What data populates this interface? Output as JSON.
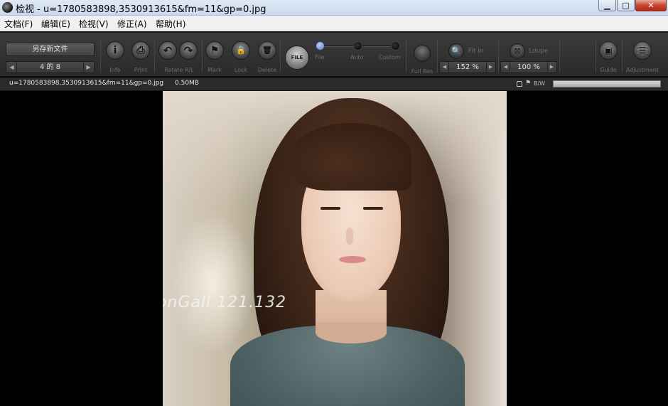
{
  "window": {
    "title": "检视 - u=1780583898,3530913615&fm=11&gp=0.jpg",
    "minimize_glyph": "▁",
    "maximize_glyph": "□",
    "close_glyph": "✕"
  },
  "menu": [
    {
      "label": "文档(F)"
    },
    {
      "label": "编辑(E)"
    },
    {
      "label": "检视(V)"
    },
    {
      "label": "修正(A)"
    },
    {
      "label": "帮助(H)"
    }
  ],
  "toolbar": {
    "save_as_label": "另存新文件",
    "page_indicator": "4 的 8",
    "prev_arrow": "◀",
    "next_arrow": "▶",
    "buttons": {
      "info": {
        "label": "Info",
        "icon": "info-icon",
        "glyph": "i"
      },
      "print": {
        "label": "Print",
        "icon": "print-icon",
        "glyph": "⎙"
      },
      "rotate_label": "Rotate R/L",
      "rotate_left_glyph": "↶",
      "rotate_right_glyph": "↷",
      "mark": {
        "label": "Mark",
        "icon": "flag-icon",
        "glyph": "⚑"
      },
      "lock": {
        "label": "Lock",
        "icon": "lock-icon",
        "glyph": "🔒"
      },
      "delete": {
        "label": "Delete",
        "icon": "trash-icon",
        "glyph": "🗑"
      }
    },
    "file_button_text": "FILE",
    "mode_slider": {
      "options": [
        "File",
        "Auto",
        "Custom"
      ],
      "selected": "File"
    },
    "full_res_label": "Full Res",
    "fit_in_label": "Fit in",
    "fit_in_glyph": "🔍",
    "fit_zoom_value": "152 %",
    "loupe_label": "Loupe",
    "loupe_glyph": "⊠",
    "loupe_zoom_value": "100 %",
    "zoom_arrow_left": "◀",
    "zoom_arrow_right": "▶",
    "guide": {
      "label": "Guide",
      "glyph": "▣"
    },
    "adjustment": {
      "label": "Adjustment",
      "glyph": "☰"
    }
  },
  "status": {
    "filename": "u=1780583898,3530913615&fm=11&gp=0.jpg",
    "filesize": "0.50MB",
    "flag_glyph": "⚑",
    "bw_label": "B/W"
  },
  "image": {
    "watermark_text": "onGall  121.132"
  },
  "colors": {
    "toolbar_bg": "#333333",
    "slider_active": "#5878b8",
    "close_red": "#c7442d"
  }
}
